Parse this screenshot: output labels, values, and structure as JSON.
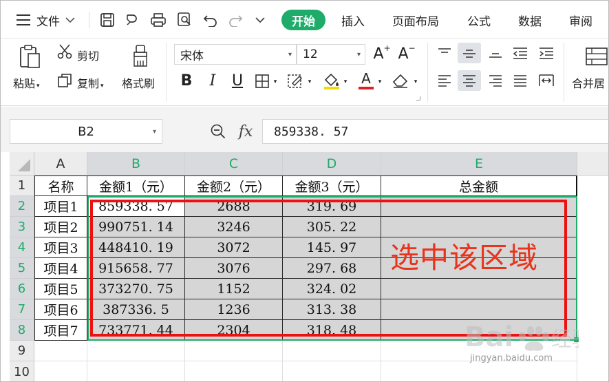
{
  "menubar": {
    "file_label": "文件",
    "tabs": [
      "开始",
      "插入",
      "页面布局",
      "公式",
      "数据",
      "审阅"
    ]
  },
  "ribbon": {
    "paste_label": "粘贴",
    "cut_label": "剪切",
    "copy_label": "复制",
    "format_painter_label": "格式刷",
    "font_name": "宋体",
    "font_size": "12",
    "merge_label": "合并居"
  },
  "formula_bar": {
    "name_box": "B2",
    "fx_label": "fx",
    "value": "859338. 57"
  },
  "sheet": {
    "columns": [
      "A",
      "B",
      "C",
      "D",
      "E"
    ],
    "rows": [
      "1",
      "2",
      "3",
      "4",
      "5",
      "6",
      "7",
      "8",
      "9",
      "10"
    ],
    "headers": [
      "名称",
      "金额1（元）",
      "金额2（元）",
      "金额3（元）",
      "总金额"
    ],
    "data": [
      [
        "项目1",
        "859338. 57",
        "2688",
        "319. 69"
      ],
      [
        "项目2",
        "990751. 14",
        "3246",
        "305. 22"
      ],
      [
        "项目3",
        "448410. 19",
        "3072",
        "145. 97"
      ],
      [
        "项目4",
        "915658. 77",
        "3076",
        "297. 68"
      ],
      [
        "项目5",
        "373270. 75",
        "1152",
        "324. 02"
      ],
      [
        "项目6",
        "387336. 5",
        "1236",
        "313. 38"
      ],
      [
        "项目7",
        "733771. 44",
        "2304",
        "318. 48"
      ]
    ]
  },
  "annotation": "选中该区域",
  "watermark": "jingyan.baidu.com",
  "colors": {
    "accent": "#1fab6a",
    "annotation_red": "#e8341c",
    "selection_gray": "#d6d6d6"
  }
}
